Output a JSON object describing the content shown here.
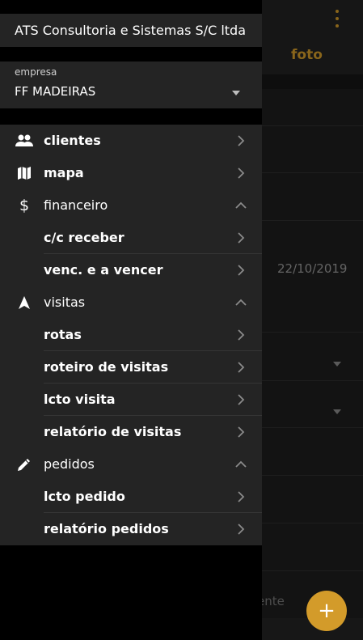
{
  "drawer": {
    "account_name": "ATS Consultoria e Sistemas S/C ltda",
    "company": {
      "label": "empresa",
      "value": "FF MADEIRAS"
    },
    "menu": [
      {
        "label": "clientes",
        "icon": "people-icon",
        "expanded": null
      },
      {
        "label": "mapa",
        "icon": "map-icon",
        "expanded": null
      },
      {
        "label": "financeiro",
        "icon": "dollar-icon",
        "expanded": true,
        "children": [
          {
            "label": "c/c receber"
          },
          {
            "label": "venc. e a vencer"
          }
        ]
      },
      {
        "label": "visitas",
        "icon": "navigation-icon",
        "expanded": true,
        "children": [
          {
            "label": "rotas"
          },
          {
            "label": "roteiro de visitas"
          },
          {
            "label": "lcto visita"
          },
          {
            "label": "relatório de visitas"
          }
        ]
      },
      {
        "label": "pedidos",
        "icon": "pencil-icon",
        "expanded": true,
        "children": [
          {
            "label": "lcto pedido"
          },
          {
            "label": "relatório pedidos"
          }
        ]
      }
    ]
  },
  "background": {
    "tab_label": "foto",
    "date_value": "22/10/2019",
    "bottom_text": "ente",
    "fab_label": "+"
  },
  "colors": {
    "accent": "#d39b2a",
    "drawer_bg": "#242424",
    "text": "#ffffff"
  }
}
